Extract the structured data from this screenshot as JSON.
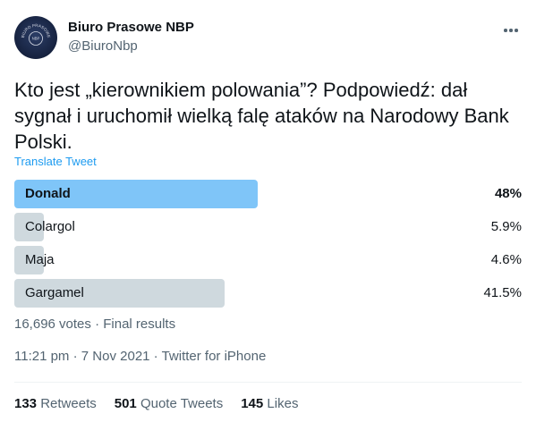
{
  "author": {
    "name": "Biuro Prasowe NBP",
    "handle": "@BiuroNbp",
    "avatar_text": "BIURO PRASOWE",
    "avatar_mark": "NBP"
  },
  "tweet": {
    "text": "Kto jest „kierownikiem polowania”? Podpowiedź: dał sygnał i uruchomił wielką falę ataków na Narodowy Bank Polski.",
    "translate_label": "Translate Tweet"
  },
  "poll": {
    "options": [
      {
        "label": "Donald",
        "percent_text": "48%",
        "percent": 48,
        "winner": true
      },
      {
        "label": "Colargol",
        "percent_text": "5.9%",
        "percent": 5.9,
        "winner": false
      },
      {
        "label": "Maja",
        "percent_text": "4.6%",
        "percent": 4.6,
        "winner": false
      },
      {
        "label": "Gargamel",
        "percent_text": "41.5%",
        "percent": 41.5,
        "winner": false
      }
    ],
    "summary": "16,696 votes · Final results"
  },
  "meta": {
    "time": "11:21 pm",
    "separator": " · ",
    "date": "7 Nov 2021",
    "source": "Twitter for iPhone"
  },
  "stats": {
    "retweets_count": "133",
    "retweets_label": "Retweets",
    "quotes_count": "501",
    "quotes_label": "Quote Tweets",
    "likes_count": "145",
    "likes_label": "Likes"
  },
  "colors": {
    "winner_bar": "#7fc5f8",
    "other_bar": "#cfd9de",
    "link": "#1d9bf0",
    "muted": "#536471"
  }
}
